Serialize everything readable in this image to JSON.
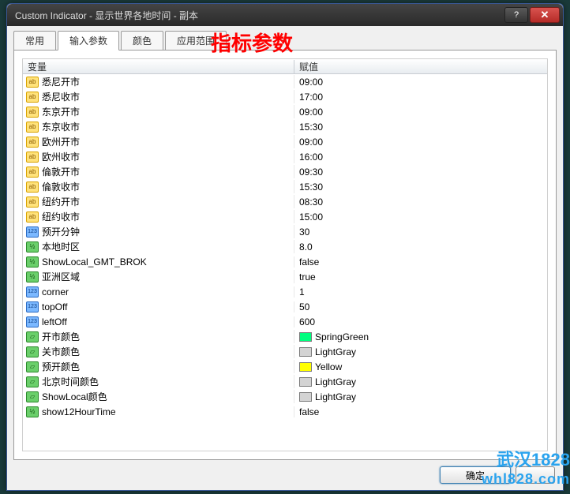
{
  "window": {
    "title": "Custom Indicator - 显示世界各地时间 - 副本"
  },
  "tabs": {
    "items": [
      "常用",
      "输入参数",
      "颜色",
      "应用范围"
    ],
    "active": 1,
    "big_label": "指标参数"
  },
  "grid": {
    "headers": {
      "var": "变量",
      "val": "赋值"
    },
    "rows": [
      {
        "type": "ab",
        "name": "悉尼开市",
        "value": "09:00"
      },
      {
        "type": "ab",
        "name": "悉尼收市",
        "value": "17:00"
      },
      {
        "type": "ab",
        "name": "东京开市",
        "value": "09:00"
      },
      {
        "type": "ab",
        "name": "东京收市",
        "value": "15:30"
      },
      {
        "type": "ab",
        "name": "欧州开市",
        "value": "09:00"
      },
      {
        "type": "ab",
        "name": "欧州收市",
        "value": "16:00"
      },
      {
        "type": "ab",
        "name": "倫敦开市",
        "value": "09:30"
      },
      {
        "type": "ab",
        "name": "倫敦收市",
        "value": "15:30"
      },
      {
        "type": "ab",
        "name": "纽约开市",
        "value": "08:30"
      },
      {
        "type": "ab",
        "name": "纽约收市",
        "value": "15:00"
      },
      {
        "type": "123",
        "name": "预开分钟",
        "value": "30"
      },
      {
        "type": "tf",
        "name": "本地时区",
        "value": "8.0"
      },
      {
        "type": "tf",
        "name": "ShowLocal_GMT_BROK",
        "value": "false"
      },
      {
        "type": "tf",
        "name": "亚洲区域",
        "value": "true"
      },
      {
        "type": "123",
        "name": "corner",
        "value": "1"
      },
      {
        "type": "123",
        "name": "topOff",
        "value": "50"
      },
      {
        "type": "123",
        "name": "leftOff",
        "value": "600"
      },
      {
        "type": "col",
        "name": "开市颜色",
        "value": "SpringGreen",
        "swatch": "#00ff7f"
      },
      {
        "type": "col",
        "name": "关市颜色",
        "value": "LightGray",
        "swatch": "#d3d3d3"
      },
      {
        "type": "col",
        "name": "预开颜色",
        "value": "Yellow",
        "swatch": "#ffff00"
      },
      {
        "type": "col",
        "name": "北京时间颜色",
        "value": "LightGray",
        "swatch": "#d3d3d3"
      },
      {
        "type": "col",
        "name": "ShowLocal颜色",
        "value": "LightGray",
        "swatch": "#d3d3d3"
      },
      {
        "type": "tf",
        "name": "show12HourTime",
        "value": "false"
      }
    ]
  },
  "footer": {
    "ok": "确定"
  },
  "watermark": {
    "line1": "武汉1828",
    "line2": "whl828.com"
  },
  "icon_text": {
    "ab": "ab",
    "123": "123",
    "tf": "½",
    "col": "▱"
  }
}
